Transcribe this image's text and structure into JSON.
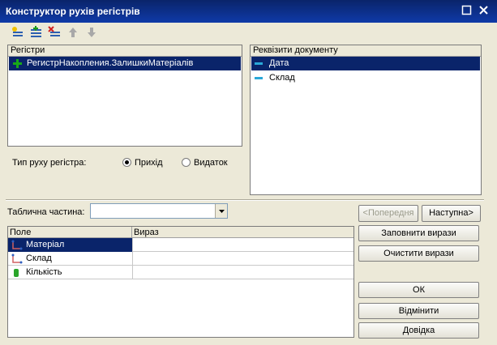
{
  "window": {
    "title": "Конструктор рухів регістрів",
    "maximize_icon": "square-icon",
    "close_icon": "x-icon"
  },
  "toolbar": {
    "icons": [
      "add-register-icon",
      "add-register-list-icon",
      "delete-register-icon",
      "move-up-icon",
      "move-down-icon"
    ]
  },
  "registers": {
    "header": "Регістри",
    "items": [
      {
        "label": "РегистрНакопления.ЗалишкиМатеріалів",
        "icon": "plus-icon"
      }
    ]
  },
  "movement_type": {
    "label": "Тип руху регістра:",
    "options": [
      {
        "label": "Прихід",
        "selected": true
      },
      {
        "label": "Видаток",
        "selected": false
      }
    ]
  },
  "doc_attrs": {
    "header": "Реквізити документу",
    "items": [
      {
        "label": "Дата",
        "selected": true
      },
      {
        "label": "Склад",
        "selected": false
      }
    ]
  },
  "table_part": {
    "label": "Таблична частина:",
    "value": ""
  },
  "nav": {
    "prev_label": "<Попередня",
    "next_label": "Наступна>"
  },
  "grid": {
    "columns": [
      "Поле",
      "Вираз"
    ],
    "rows": [
      {
        "field": "Матеріал",
        "expr": "",
        "selected": true
      },
      {
        "field": "Склад",
        "expr": "",
        "selected": false
      },
      {
        "field": "Кількість",
        "expr": "",
        "selected": false
      }
    ]
  },
  "actions": {
    "fill_label": "Заповнити вирази",
    "clear_label": "Очистити вирази",
    "ok_label": "ОК",
    "cancel_label": "Відмінити",
    "help_label": "Довідка"
  }
}
